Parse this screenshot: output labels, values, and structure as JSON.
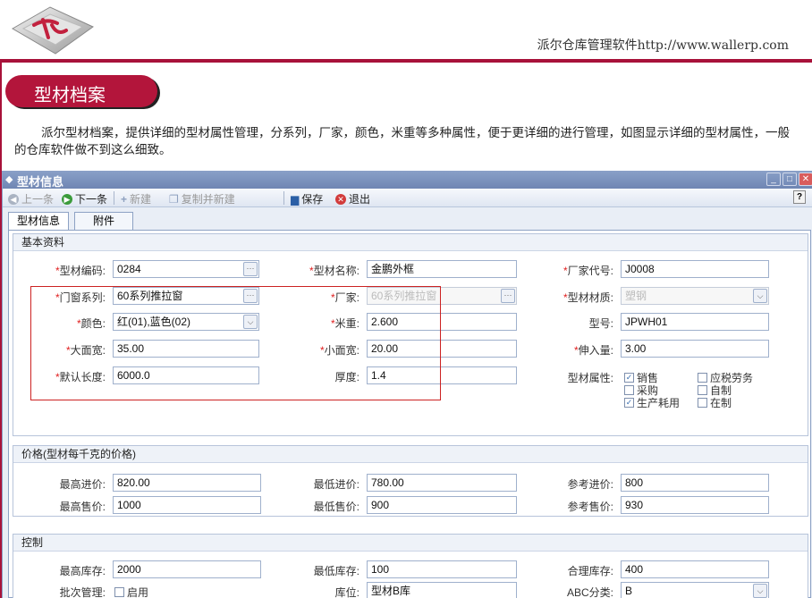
{
  "header": {
    "site_text": "派尔仓库管理软件http://www.wallerp.com"
  },
  "section": {
    "title": "型材档案"
  },
  "intro": "派尔型材档案，提供详细的型材属性管理，分系列，厂家，颜色，米重等多种属性，便于更详细的进行管理，如图显示详细的型材属性，一般的仓库软件做不到这么细致。",
  "window": {
    "title": "型材信息",
    "toolbar": {
      "prev": "上一条",
      "next": "下一条",
      "new": "新建",
      "copy_new": "复制并新建",
      "save": "保存",
      "exit": "退出",
      "help": "?"
    },
    "tabs": [
      "型材信息",
      "附件"
    ]
  },
  "basic": {
    "header": "基本资料",
    "code_label": "型材编码:",
    "code": "0284",
    "name_label": "型材名称:",
    "name": "金鹏外框",
    "vendor_code_label": "厂家代号:",
    "vendor_code": "J0008",
    "series_label": "门窗系列:",
    "series": "60系列推拉窗",
    "vendor_label": "厂家:",
    "vendor": "60系列推拉窗",
    "material_label": "型材材质:",
    "material": "塑钢",
    "color_label": "颜色:",
    "color": "红(01),蓝色(02)",
    "weight_label": "米重:",
    "weight": "2.600",
    "model_label": "型号:",
    "model": "JPWH01",
    "big_width_label": "大面宽:",
    "big_width": "35.00",
    "small_width_label": "小面宽:",
    "small_width": "20.00",
    "insert_label": "伸入量:",
    "insert": "3.00",
    "default_len_label": "默认长度:",
    "default_len": "6000.0",
    "thickness_label": "厚度:",
    "thickness": "1.4",
    "attr_label": "型材属性:",
    "attrs": [
      {
        "label": "销售",
        "checked": true
      },
      {
        "label": "应税劳务",
        "checked": false
      },
      {
        "label": "采购",
        "checked": false
      },
      {
        "label": "自制",
        "checked": false
      },
      {
        "label": "生产耗用",
        "checked": true
      },
      {
        "label": "在制",
        "checked": false
      }
    ]
  },
  "price": {
    "header": "价格(型材每千克的价格)",
    "max_in_label": "最高进价:",
    "max_in": "820.00",
    "min_in_label": "最低进价:",
    "min_in": "780.00",
    "ref_in_label": "参考进价:",
    "ref_in": "800",
    "max_out_label": "最高售价:",
    "max_out": "1000",
    "min_out_label": "最低售价:",
    "min_out": "900",
    "ref_out_label": "参考售价:",
    "ref_out": "930"
  },
  "control": {
    "header": "控制",
    "max_stock_label": "最高库存:",
    "max_stock": "2000",
    "min_stock_label": "最低库存:",
    "min_stock": "100",
    "reason_stock_label": "合理库存:",
    "reason_stock": "400",
    "batch_label": "批次管理:",
    "batch_enable": "启用",
    "location_label": "库位:",
    "location": "型材B库",
    "abc_label": "ABC分类:",
    "abc": "B"
  },
  "colors": {
    "brand_red": "#a8123a",
    "titlebar": "#7b90bd"
  }
}
